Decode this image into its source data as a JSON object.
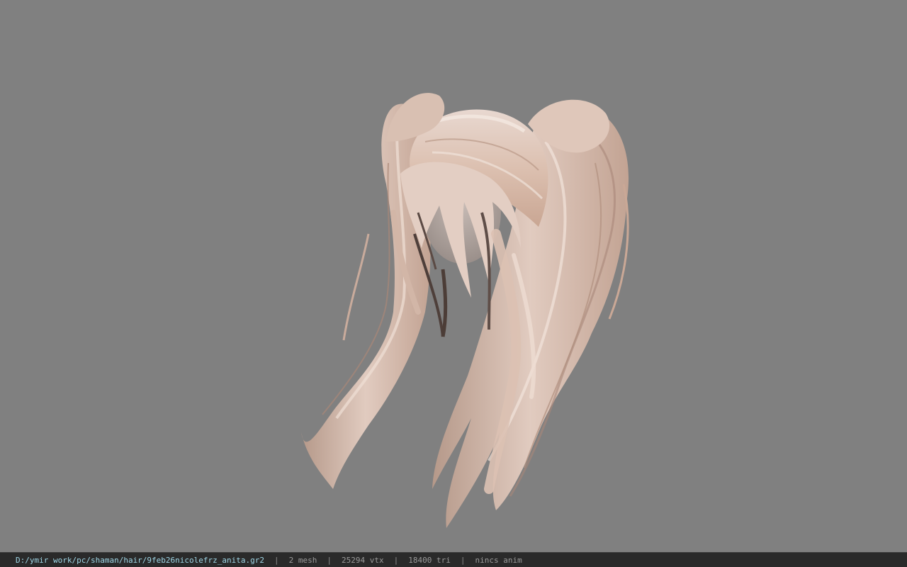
{
  "viewport": {
    "background": "#808080",
    "model_icon": "hair-model-icon"
  },
  "statusbar": {
    "path": "D:/ymir work/pc/shaman/hair/9feb26nicolefrz_anita.gr2",
    "separator": "|",
    "mesh": "2 mesh",
    "vtx": "25294 vtx",
    "tri": "18400 tri",
    "anim": "nincs anim"
  },
  "colors": {
    "hair_light": "#e6cfc3",
    "hair_mid": "#caa896",
    "hair_dark": "#6d5a52",
    "scalp": "#bfb3ae",
    "path_text": "#9fd6e6",
    "status_bg": "#2a2a2a"
  }
}
